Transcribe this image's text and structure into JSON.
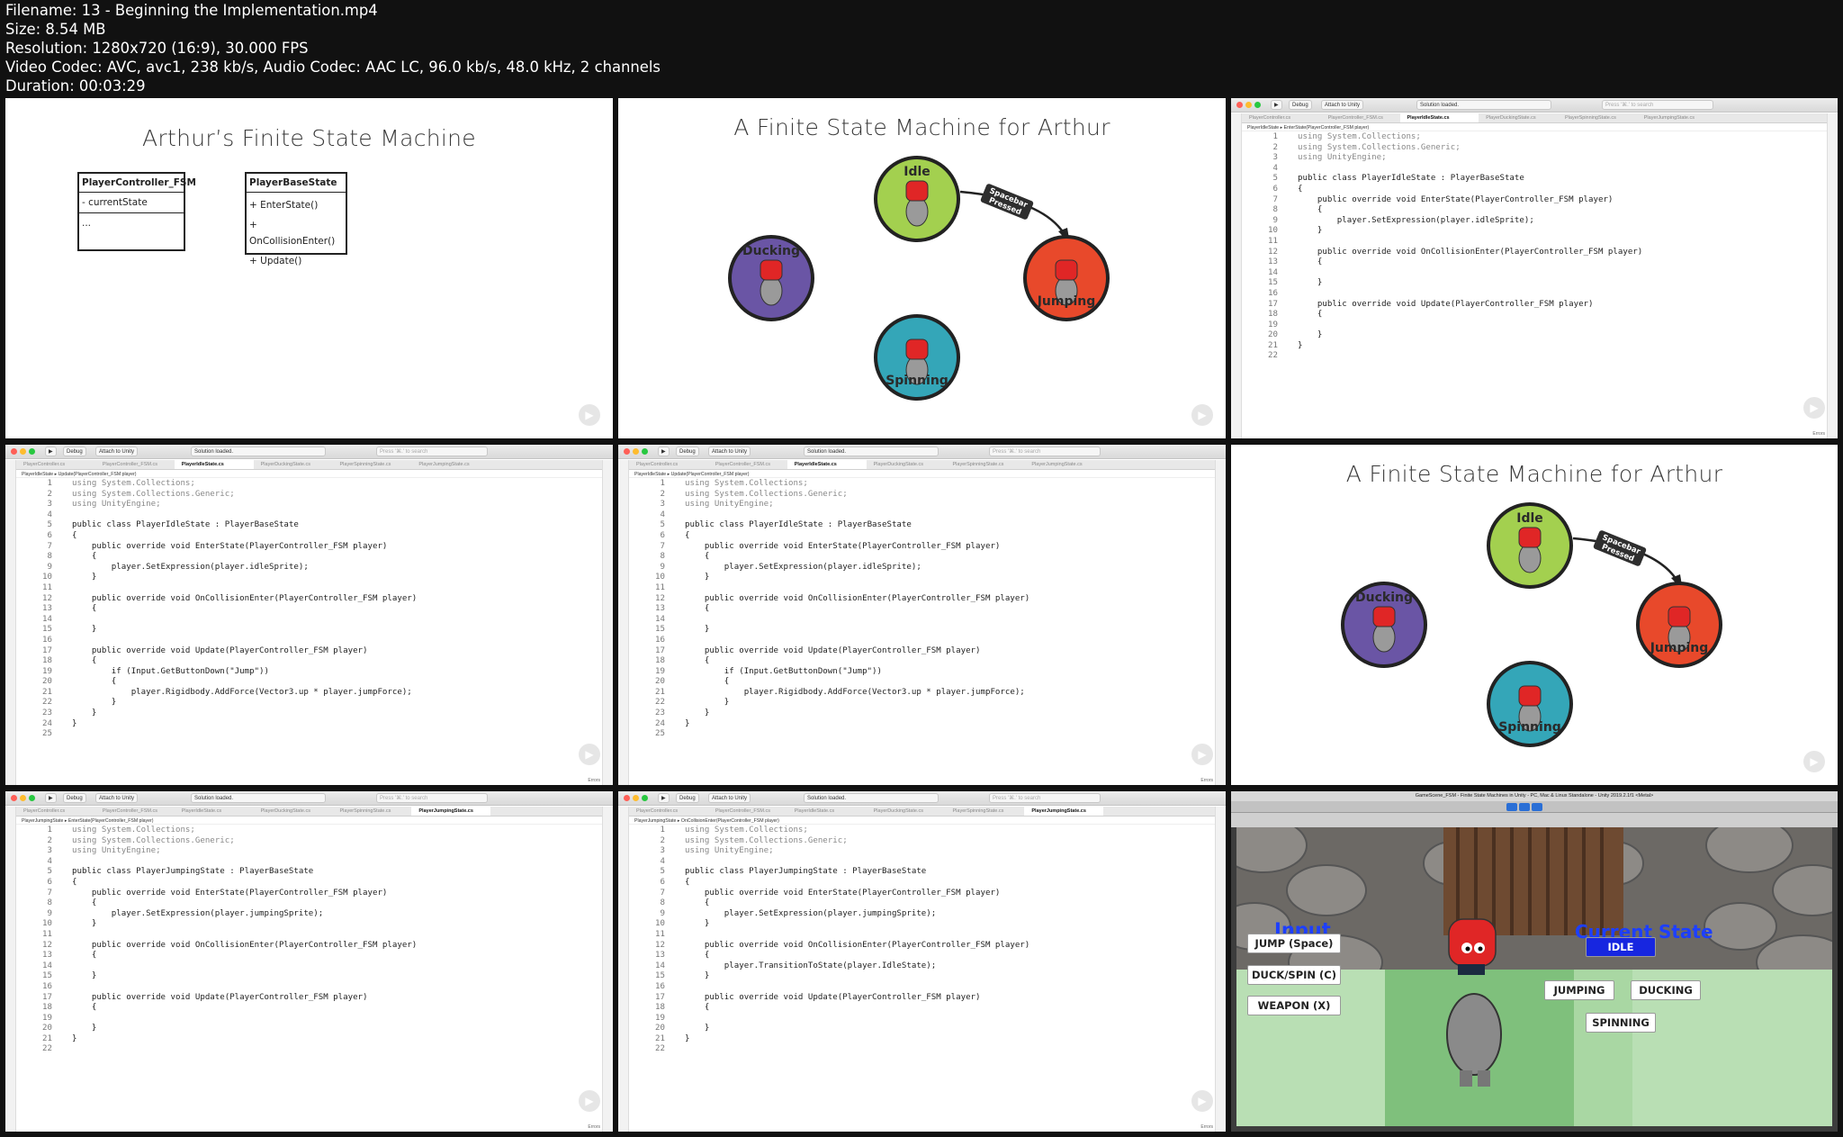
{
  "file_info": {
    "filename": "Filename: 13 - Beginning the Implementation.mp4",
    "size": "Size: 8.54 MB",
    "resolution": "Resolution: 1280x720 (16:9), 30.000 FPS",
    "codec": "Video Codec: AVC, avc1, 238 kb/s, Audio Codec: AAC LC, 96.0 kb/s, 48.0 kHz, 2 channels",
    "duration": "Duration: 00:03:29"
  },
  "uml_slide": {
    "title": "Arthur’s Finite State Machine",
    "class1": {
      "name": "PlayerController_FSM",
      "fields": [
        "- currentState"
      ],
      "methods": [
        "..."
      ]
    },
    "class2": {
      "name": "PlayerBaseState",
      "methods": [
        "+ EnterState()",
        "+ OnCollisionEnter()",
        "+ Update()"
      ]
    }
  },
  "fsm_slide": {
    "title": "A Finite State Machine for Arthur",
    "states": {
      "idle": "Idle",
      "ducking": "Ducking",
      "jumping": "Jumping",
      "spinning": "Spinning"
    },
    "transition_label": "Spacebar Pressed",
    "colors": {
      "idle": "#a3d04f",
      "ducking": "#6a55a5",
      "jumping": "#e8492b",
      "spinning": "#34a6b8"
    }
  },
  "ide": {
    "run_target": "Debug",
    "attach": "Attach to Unity",
    "status": "Solution loaded.",
    "search_placeholder": "Press '⌘.' to search",
    "tabs": [
      "PlayerController.cs",
      "PlayerController_FSM.cs",
      "PlayerIdleState.cs",
      "PlayerDuckingState.cs",
      "PlayerSpinningState.cs",
      "PlayerJumpingState.cs"
    ],
    "errors": "Errors"
  },
  "code": {
    "idle_a": {
      "active_tab": 2,
      "crumb": "PlayerIdleState  ▸  EnterState(PlayerController_FSM player)",
      "lines": [
        "using System.Collections;",
        "using System.Collections.Generic;",
        "using UnityEngine;",
        "",
        "public class PlayerIdleState : PlayerBaseState",
        "{",
        "    public override void EnterState(PlayerController_FSM player)",
        "    {",
        "        player.SetExpression(player.idleSprite);",
        "    }",
        "",
        "    public override void OnCollisionEnter(PlayerController_FSM player)",
        "    {",
        "",
        "    }",
        "",
        "    public override void Update(PlayerController_FSM player)",
        "    {",
        "",
        "    }",
        "}",
        ""
      ]
    },
    "idle_b": {
      "active_tab": 2,
      "crumb": "PlayerIdleState  ▸  Update(PlayerController_FSM player)",
      "lines": [
        "using System.Collections;",
        "using System.Collections.Generic;",
        "using UnityEngine;",
        "",
        "public class PlayerIdleState : PlayerBaseState",
        "{",
        "    public override void EnterState(PlayerController_FSM player)",
        "    {",
        "        player.SetExpression(player.idleSprite);",
        "    }",
        "",
        "    public override void OnCollisionEnter(PlayerController_FSM player)",
        "    {",
        "",
        "    }",
        "",
        "    public override void Update(PlayerController_FSM player)",
        "    {",
        "        if (Input.GetButtonDown(\"Jump\"))",
        "        {",
        "            player.Rigidbody.AddForce(Vector3.up * player.jumpForce);",
        "        }",
        "    }",
        "}",
        ""
      ]
    },
    "jump_a": {
      "active_tab": 5,
      "crumb": "PlayerJumpingState  ▸  EnterState(PlayerController_FSM player)",
      "lines": [
        "using System.Collections;",
        "using System.Collections.Generic;",
        "using UnityEngine;",
        "",
        "public class PlayerJumpingState : PlayerBaseState",
        "{",
        "    public override void EnterState(PlayerController_FSM player)",
        "    {",
        "        player.SetExpression(player.jumpingSprite);",
        "    }",
        "",
        "    public override void OnCollisionEnter(PlayerController_FSM player)",
        "    {",
        "",
        "    }",
        "",
        "    public override void Update(PlayerController_FSM player)",
        "    {",
        "",
        "    }",
        "}",
        ""
      ]
    },
    "jump_b": {
      "active_tab": 5,
      "crumb": "PlayerJumpingState  ▸  OnCollisionEnter(PlayerController_FSM player)",
      "lines": [
        "using System.Collections;",
        "using System.Collections.Generic;",
        "using UnityEngine;",
        "",
        "public class PlayerJumpingState : PlayerBaseState",
        "{",
        "    public override void EnterState(PlayerController_FSM player)",
        "    {",
        "        player.SetExpression(player.jumpingSprite);",
        "    }",
        "",
        "    public override void OnCollisionEnter(PlayerController_FSM player)",
        "    {",
        "        player.TransitionToState(player.IdleState);",
        "    }",
        "",
        "    public override void Update(PlayerController_FSM player)",
        "    {",
        "",
        "    }",
        "}",
        ""
      ]
    }
  },
  "unity": {
    "window_title": "GameScene_FSM - Finite State Machines in Unity - PC, Mac & Linux Standalone - Unity 2019.2.1f1 <Metal>",
    "input_heading": "Input",
    "state_heading": "Current State",
    "input_buttons": [
      "JUMP (Space)",
      "DUCK/SPIN (C)",
      "WEAPON (X)"
    ],
    "state_buttons": {
      "idle": "IDLE",
      "jumping": "JUMPING",
      "ducking": "DUCKING",
      "spinning": "SPINNING"
    },
    "active_state": "IDLE"
  }
}
